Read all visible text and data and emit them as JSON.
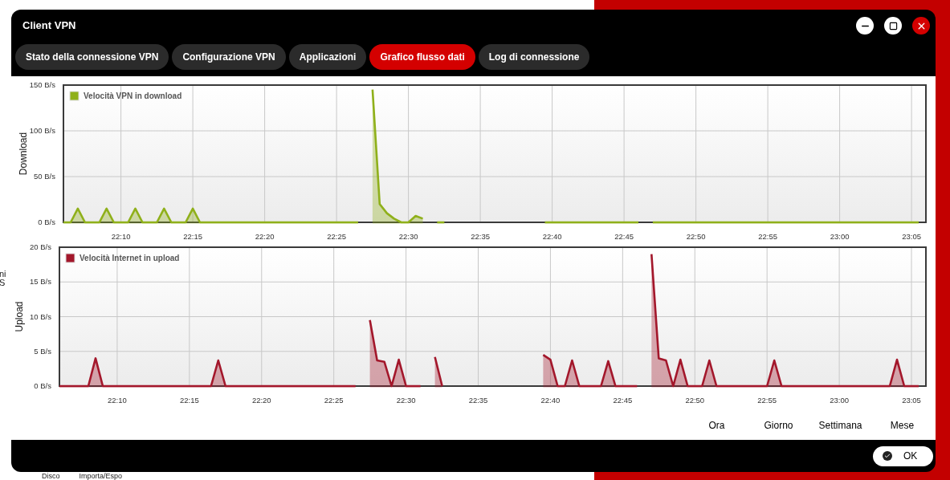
{
  "background": {
    "side_texts": [
      "ni",
      "S"
    ],
    "bottom_texts": [
      "Disco",
      "Importa/Espo"
    ]
  },
  "window": {
    "title": "Client VPN"
  },
  "tabs": [
    {
      "label": "Stato della connessione VPN",
      "selected": false
    },
    {
      "label": "Configurazione VPN",
      "selected": false
    },
    {
      "label": "Applicazioni",
      "selected": false
    },
    {
      "label": "Grafico flusso dati",
      "selected": true
    },
    {
      "label": "Log di connessione",
      "selected": false
    }
  ],
  "charts": [
    {
      "chart_data": {
        "type": "area",
        "ylabel": "Download",
        "grid": true,
        "ylim": [
          0,
          150
        ],
        "yticks": [
          {
            "value": 0,
            "label": "0 B/s"
          },
          {
            "value": 50,
            "label": "50 B/s"
          },
          {
            "value": 100,
            "label": "100 B/s"
          },
          {
            "value": 150,
            "label": "150 B/s"
          }
        ],
        "categories": [
          null,
          null,
          null,
          null,
          null,
          null,
          null,
          null,
          "22:10",
          null,
          null,
          null,
          null,
          null,
          null,
          null,
          null,
          null,
          "22:15",
          null,
          null,
          null,
          null,
          null,
          null,
          null,
          null,
          null,
          "22:20",
          null,
          null,
          null,
          null,
          null,
          null,
          null,
          null,
          null,
          "22:25",
          null,
          null,
          null,
          null,
          null,
          null,
          null,
          null,
          null,
          "22:30",
          null,
          null,
          null,
          null,
          null,
          null,
          null,
          null,
          null,
          "22:35",
          null,
          null,
          null,
          null,
          null,
          null,
          null,
          null,
          null,
          "22:40",
          null,
          null,
          null,
          null,
          null,
          null,
          null,
          null,
          null,
          "22:45",
          null,
          null,
          null,
          null,
          null,
          null,
          null,
          null,
          null,
          "22:50",
          null,
          null,
          null,
          null,
          null,
          null,
          null,
          null,
          null,
          "22:55",
          null,
          null,
          null,
          null,
          null,
          null,
          null,
          null,
          null,
          "23:00",
          null,
          null,
          null,
          null,
          null,
          null,
          null,
          null,
          null,
          "23:05",
          null,
          null
        ],
        "series": [
          {
            "name": "Velocità VPN in download",
            "color": "#8fb01a",
            "values": [
              0,
              0,
              15,
              0,
              0,
              0,
              15,
              0,
              0,
              0,
              15,
              0,
              0,
              0,
              15,
              0,
              0,
              0,
              15,
              0,
              0,
              0,
              0,
              0,
              0,
              0,
              0,
              0,
              0,
              0,
              0,
              0,
              0,
              0,
              0,
              0,
              0,
              0,
              0,
              0,
              0,
              0,
              null,
              145,
              20,
              10,
              4,
              0,
              0,
              7,
              4,
              null,
              0,
              0,
              null,
              null,
              null,
              null,
              null,
              null,
              null,
              null,
              null,
              null,
              null,
              null,
              null,
              0,
              0,
              0,
              0,
              0,
              0,
              0,
              0,
              0,
              0,
              0,
              0,
              0,
              0,
              null,
              0,
              0,
              0,
              0,
              0,
              0,
              0,
              0,
              0,
              0,
              0,
              0,
              0,
              0,
              0,
              0,
              0,
              0,
              0,
              0,
              0,
              0,
              0,
              0,
              0,
              0,
              0,
              0,
              0,
              0,
              0,
              0,
              0,
              0,
              0,
              0,
              0,
              0,
              null
            ]
          }
        ]
      }
    },
    {
      "chart_data": {
        "type": "area",
        "ylabel": "Upload",
        "grid": true,
        "ylim": [
          0,
          20
        ],
        "yticks": [
          {
            "value": 0,
            "label": "0 B/s"
          },
          {
            "value": 5,
            "label": "5 B/s"
          },
          {
            "value": 10,
            "label": "10 B/s"
          },
          {
            "value": 15,
            "label": "15 B/s"
          },
          {
            "value": 20,
            "label": "20 B/s"
          }
        ],
        "categories": [
          null,
          null,
          null,
          null,
          null,
          null,
          null,
          null,
          "22:10",
          null,
          null,
          null,
          null,
          null,
          null,
          null,
          null,
          null,
          "22:15",
          null,
          null,
          null,
          null,
          null,
          null,
          null,
          null,
          null,
          "22:20",
          null,
          null,
          null,
          null,
          null,
          null,
          null,
          null,
          null,
          "22:25",
          null,
          null,
          null,
          null,
          null,
          null,
          null,
          null,
          null,
          "22:30",
          null,
          null,
          null,
          null,
          null,
          null,
          null,
          null,
          null,
          "22:35",
          null,
          null,
          null,
          null,
          null,
          null,
          null,
          null,
          null,
          "22:40",
          null,
          null,
          null,
          null,
          null,
          null,
          null,
          null,
          null,
          "22:45",
          null,
          null,
          null,
          null,
          null,
          null,
          null,
          null,
          null,
          "22:50",
          null,
          null,
          null,
          null,
          null,
          null,
          null,
          null,
          null,
          "22:55",
          null,
          null,
          null,
          null,
          null,
          null,
          null,
          null,
          null,
          "23:00",
          null,
          null,
          null,
          null,
          null,
          null,
          null,
          null,
          null,
          "23:05",
          null,
          null
        ],
        "series": [
          {
            "name": "Velocità Internet in upload",
            "color": "#a3172b",
            "values": [
              0,
              0,
              0,
              0,
              0,
              4,
              0,
              0,
              0,
              0,
              0,
              0,
              0,
              0,
              0,
              0,
              0,
              0,
              0,
              0,
              0,
              0,
              3.7,
              0,
              0,
              0,
              0,
              0,
              0,
              0,
              0,
              0,
              0,
              0,
              0,
              0,
              0,
              0,
              0,
              0,
              0,
              0,
              null,
              9.5,
              3.7,
              3.5,
              0,
              3.8,
              0,
              0,
              0,
              null,
              4.2,
              0,
              null,
              null,
              null,
              null,
              null,
              null,
              null,
              null,
              null,
              null,
              null,
              null,
              null,
              4.5,
              3.8,
              0,
              0,
              3.7,
              0,
              0,
              0,
              0,
              3.6,
              0,
              0,
              0,
              0,
              null,
              19,
              4,
              3.7,
              0,
              3.8,
              0,
              0,
              0,
              3.7,
              0,
              0,
              0,
              0,
              0,
              0,
              0,
              0,
              3.7,
              0,
              0,
              0,
              0,
              0,
              0,
              0,
              0,
              0,
              0,
              0,
              0,
              0,
              0,
              0,
              0,
              3.8,
              0,
              0,
              0,
              null
            ]
          }
        ]
      }
    }
  ],
  "range_buttons": [
    "Ora",
    "Giorno",
    "Settimana",
    "Mese"
  ],
  "ok_button": {
    "label": "OK"
  }
}
